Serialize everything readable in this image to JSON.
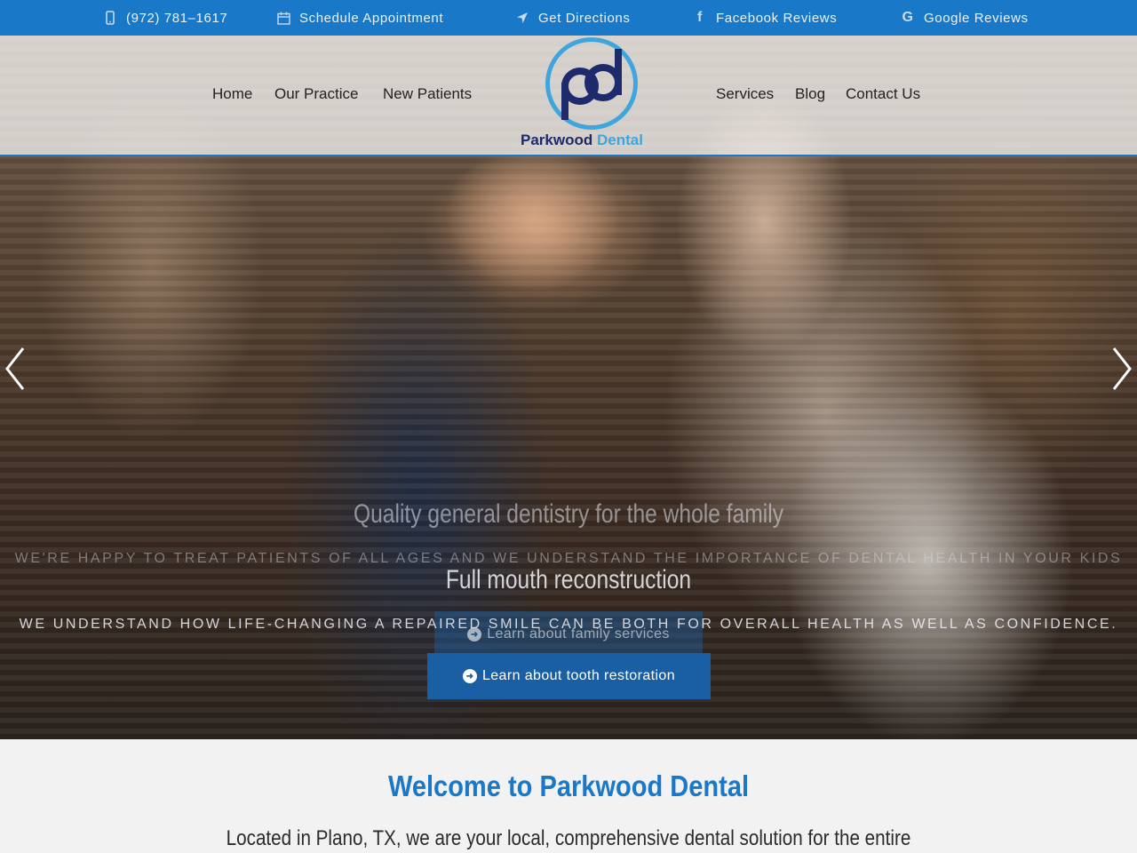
{
  "topbar": {
    "phone": "(972) 781–1617",
    "schedule": "Schedule Appointment",
    "directions": "Get Directions",
    "facebook": "Facebook Reviews",
    "google": "Google Reviews"
  },
  "nav": {
    "home": "Home",
    "practice": "Our Practice",
    "new_patients": "New Patients",
    "services": "Services",
    "blog": "Blog",
    "contact": "Contact Us"
  },
  "logo": {
    "monogram": "pd",
    "name_part1": "Parkwood",
    "name_part2": "Dental"
  },
  "slides": [
    {
      "heading": "Quality general dentistry for the whole family",
      "text": "We're happy to treat patients of all ages and we understand the importance of dental health in your kids",
      "button": "Learn about family services"
    },
    {
      "heading": "Full mouth reconstruction",
      "text": "We understand how life-changing a repaired smile can be both for overall health as well as confidence.",
      "button": "Learn about tooth restoration"
    }
  ],
  "welcome": {
    "title": "Welcome to Parkwood Dental",
    "subtitle": "Located in Plano, TX, we are your local, comprehensive dental solution for the entire"
  },
  "colors": {
    "brand_blue": "#1a78c8",
    "logo_navy": "#1d2a6b",
    "logo_light_blue": "#3fa6dd"
  }
}
